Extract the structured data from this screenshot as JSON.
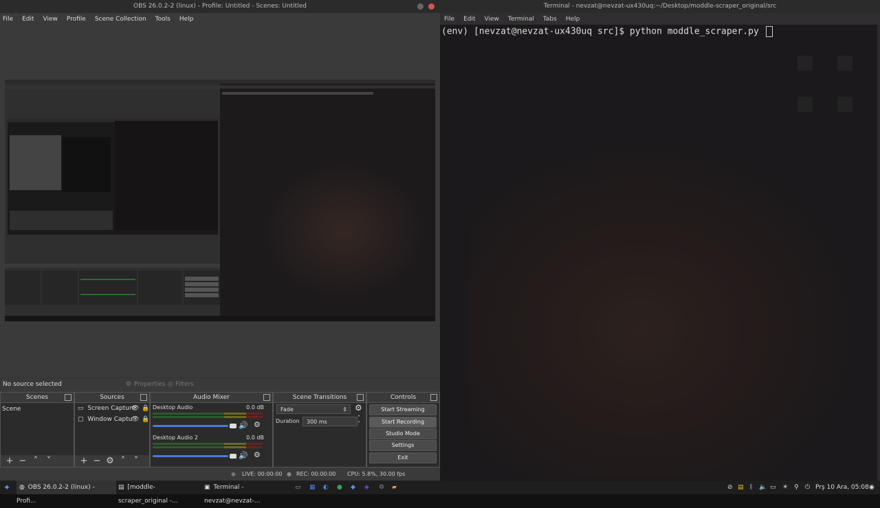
{
  "obs": {
    "title": "OBS 26.0.2-2 (linux) - Profile: Untitled - Scenes: Untitled",
    "menu": [
      "File",
      "Edit",
      "View",
      "Profile",
      "Scene Collection",
      "Tools",
      "Help"
    ],
    "source_status": "No source selected",
    "properties_label": "Properties",
    "filters_label": "Filters",
    "docks": {
      "scenes": {
        "title": "Scenes",
        "items": [
          "Scene"
        ]
      },
      "sources": {
        "title": "Sources",
        "items": [
          "Screen Capture",
          "Window Captu"
        ]
      },
      "mixer": {
        "title": "Audio Mixer",
        "channels": [
          {
            "name": "Desktop Audio",
            "level": "0.0 dB"
          },
          {
            "name": "Desktop Audio 2",
            "level": "0.0 dB"
          }
        ]
      },
      "transitions": {
        "title": "Scene Transitions",
        "selected": "Fade",
        "duration_label": "Duration",
        "duration_value": "300 ms"
      },
      "controls": {
        "title": "Controls",
        "start_streaming": "Start Streaming",
        "start_recording": "Start Recording",
        "studio_mode": "Studio Mode",
        "settings": "Settings",
        "exit": "Exit"
      }
    },
    "status": {
      "live": "LIVE: 00:00:00",
      "rec": "REC: 00:00:00",
      "cpu": "CPU: 5.8%, 30.00 fps"
    }
  },
  "terminal": {
    "title": "Terminal - nevzat@nevzat-ux430uq:~/Desktop/moddle-scraper_original/src",
    "menu": [
      "File",
      "Edit",
      "View",
      "Terminal",
      "Tabs",
      "Help"
    ],
    "command_line": "(env) [nevzat@nevzat-ux430uq src]$ python moddle_scraper.py "
  },
  "taskbar": {
    "tasks": [
      "OBS 26.0.2-2 (linux) - Profi...",
      "[moddle-scraper_original -...",
      "Terminal - nevzat@nevzat-..."
    ],
    "clock": "Prş 10 Ara, 05:08"
  }
}
